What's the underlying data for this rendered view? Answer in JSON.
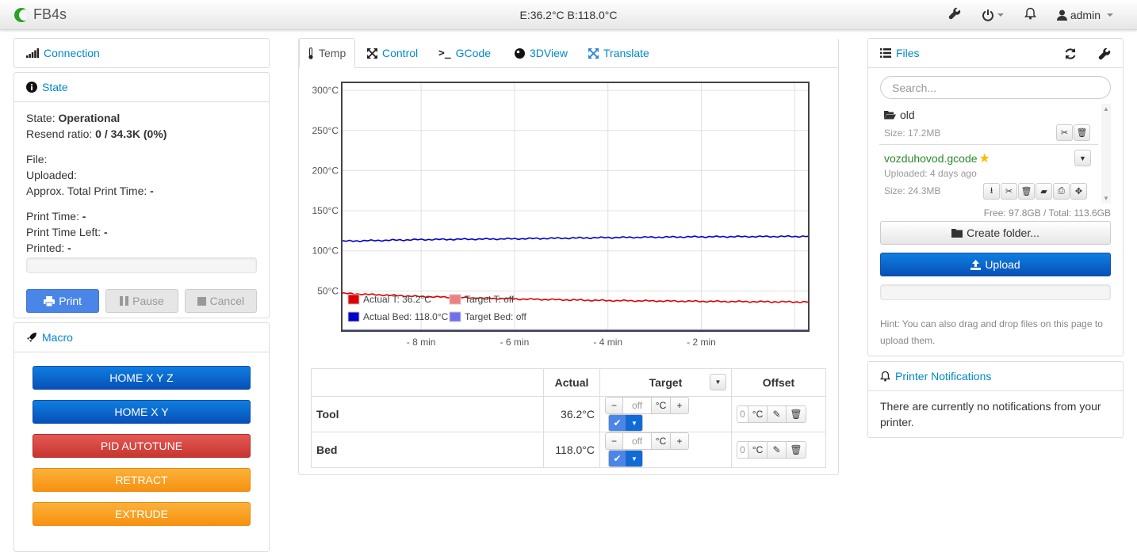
{
  "navbar": {
    "brand": "FB4s",
    "temps": "E:36.2°C B:118.0°C",
    "user": "admin"
  },
  "connection": {
    "title": "Connection"
  },
  "state": {
    "title": "State",
    "state_label": "State:",
    "state_value": "Operational",
    "resend_label": "Resend ratio:",
    "resend_value": "0 / 34.3K (0%)",
    "file_label": "File:",
    "uploaded_label": "Uploaded:",
    "approx_label": "Approx. Total Print Time:",
    "approx_value": "-",
    "print_time_label": "Print Time:",
    "print_time_value": "-",
    "time_left_label": "Print Time Left:",
    "time_left_value": "-",
    "printed_label": "Printed:",
    "printed_value": "-",
    "print_button": "Print",
    "pause_button": "Pause",
    "cancel_button": "Cancel"
  },
  "macro": {
    "title": "Macro",
    "buttons": [
      "HOME X Y Z",
      "HOME X Y",
      "PID AUTOTUNE",
      "RETRACT",
      "EXTRUDE"
    ]
  },
  "tabs": [
    "Temp",
    "Control",
    "GCode",
    "3DView",
    "Translate"
  ],
  "chart_data": {
    "type": "line",
    "y_ticks": [
      "300°C",
      "250°C",
      "200°C",
      "150°C",
      "100°C",
      "50°C"
    ],
    "x_ticks": [
      "- 8 min",
      "- 6 min",
      "- 4 min",
      "- 2 min"
    ],
    "ylim": [
      0,
      310
    ],
    "xlim": [
      -9.7,
      0.3
    ],
    "legend": [
      "Actual T: 36.2°C",
      "Target T: off",
      "Actual Bed: 118.0°C",
      "Target Bed: off"
    ],
    "series": [
      {
        "name": "Actual T: 36.2°C",
        "color": "#e00000",
        "x": [
          -9.7,
          -8,
          -6,
          -4,
          -2,
          0.3
        ],
        "y": [
          47,
          43,
          40,
          38,
          37,
          36.2
        ]
      },
      {
        "name": "Actual Bed: 118.0°C",
        "color": "#0000cc",
        "x": [
          -9.7,
          -8,
          -6,
          -4,
          -2,
          0.3
        ],
        "y": [
          112,
          114,
          115,
          116.5,
          117.5,
          118
        ]
      },
      {
        "name": "Target T: off",
        "color": "#f08080",
        "x": [],
        "y": []
      },
      {
        "name": "Target Bed: off",
        "color": "#7070ee",
        "x": [],
        "y": []
      }
    ]
  },
  "temp_table": {
    "headers": [
      "Actual",
      "Target",
      "Offset"
    ],
    "rows": [
      {
        "name": "Tool",
        "actual": "36.2°C",
        "target": "off",
        "offset": "0"
      },
      {
        "name": "Bed",
        "actual": "118.0°C",
        "target": "off",
        "offset": "0"
      }
    ],
    "unit": "°C"
  },
  "files": {
    "title": "Files",
    "search_placeholder": "Search...",
    "items": [
      {
        "name": "old",
        "size": "Size: 17.2MB"
      },
      {
        "name": "vozduhovod.gcode",
        "uploaded": "Uploaded: 4 days ago",
        "size": "Size: 24.3MB"
      }
    ],
    "free": "Free: 97.8GB / Total: 113.6GB",
    "create_folder": "Create folder...",
    "upload": "Upload",
    "hint": "Hint: You can also drag and drop files on this page to upload them."
  },
  "notifications": {
    "title": "Printer Notifications",
    "text": "There are currently no notifications from your printer."
  }
}
